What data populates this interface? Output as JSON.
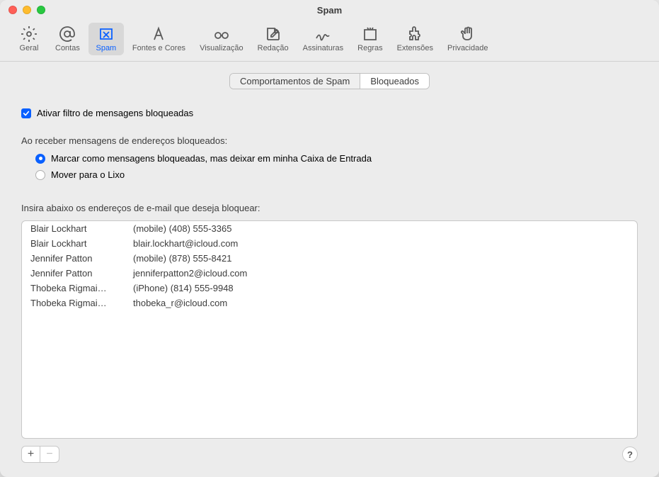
{
  "window": {
    "title": "Spam"
  },
  "toolbar": [
    {
      "id": "geral",
      "label": "Geral"
    },
    {
      "id": "contas",
      "label": "Contas"
    },
    {
      "id": "spam",
      "label": "Spam"
    },
    {
      "id": "fontes",
      "label": "Fontes e Cores"
    },
    {
      "id": "visualizacao",
      "label": "Visualização"
    },
    {
      "id": "redacao",
      "label": "Redação"
    },
    {
      "id": "assinaturas",
      "label": "Assinaturas"
    },
    {
      "id": "regras",
      "label": "Regras"
    },
    {
      "id": "extensoes",
      "label": "Extensões"
    },
    {
      "id": "privacidade",
      "label": "Privacidade"
    }
  ],
  "tabs": {
    "behaviors": "Comportamentos de Spam",
    "blocked": "Bloqueados"
  },
  "checkbox": {
    "enable_filter": "Ativar filtro de mensagens bloqueadas"
  },
  "section": {
    "receive_heading": "Ao receber mensagens de endereços bloqueados:",
    "table_heading": "Insira abaixo os endereços de e-mail que deseja bloquear:"
  },
  "radios": {
    "mark_inbox": "Marcar como mensagens bloqueadas, mas deixar em minha Caixa de Entrada",
    "move_trash": "Mover para o Lixo"
  },
  "blocked_list": [
    {
      "name": "Blair Lockhart",
      "address": "(mobile) (408) 555-3365"
    },
    {
      "name": "Blair Lockhart",
      "address": "blair.lockhart@icloud.com"
    },
    {
      "name": "Jennifer Patton",
      "address": "(mobile) (878) 555-8421"
    },
    {
      "name": "Jennifer Patton",
      "address": "jenniferpatton2@icloud.com"
    },
    {
      "name": "Thobeka Rigmai…",
      "address": "(iPhone) (814) 555-9948"
    },
    {
      "name": "Thobeka Rigmai…",
      "address": "thobeka_r@icloud.com"
    }
  ],
  "footer": {
    "add": "+",
    "remove": "−",
    "help": "?"
  }
}
